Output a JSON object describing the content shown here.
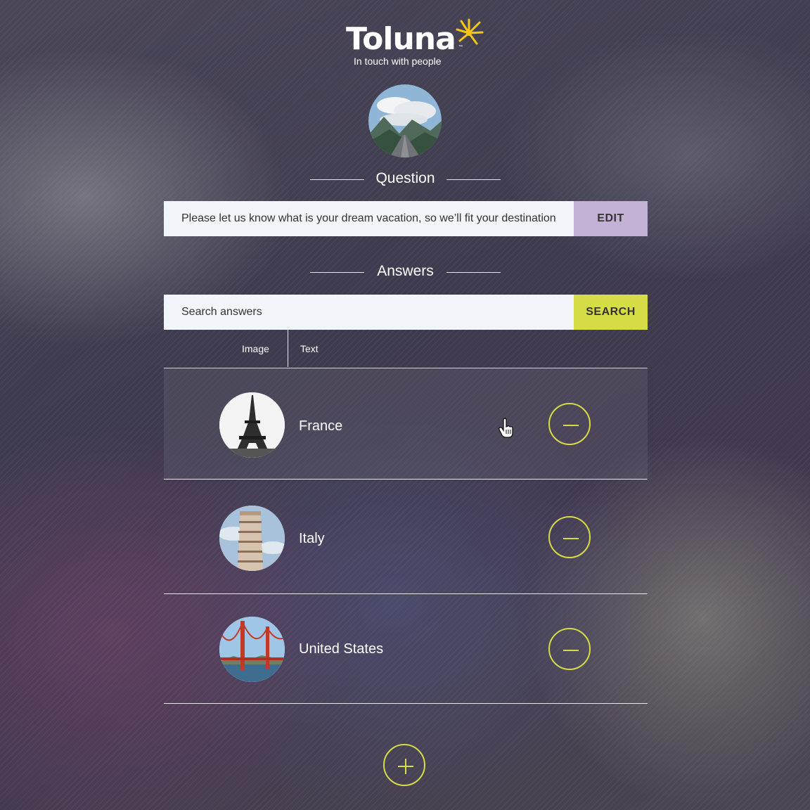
{
  "brand": {
    "name": "Toluna",
    "tm": "™",
    "tagline": "In touch with people",
    "accent_color": "#f5c518"
  },
  "question": {
    "heading": "Question",
    "text": "Please let us know what is your dream vacation, so we’ll fit your destination",
    "edit_label": "EDIT",
    "edit_color": "#c4b1d6",
    "image_icon": "mountain-road-photo"
  },
  "answers": {
    "heading": "Answers",
    "search_placeholder": "Search answers",
    "search_label": "SEARCH",
    "search_color": "#d6dc45",
    "tabs": [
      {
        "label": "Image"
      },
      {
        "label": "Text"
      }
    ],
    "items": [
      {
        "label": "France",
        "image_icon": "eiffel-tower-photo"
      },
      {
        "label": "Italy",
        "image_icon": "leaning-tower-of-pisa-photo"
      },
      {
        "label": "United States",
        "image_icon": "golden-gate-bridge-photo"
      }
    ],
    "remove_icon": "minus-circle-icon",
    "add_icon": "plus-circle-icon"
  }
}
